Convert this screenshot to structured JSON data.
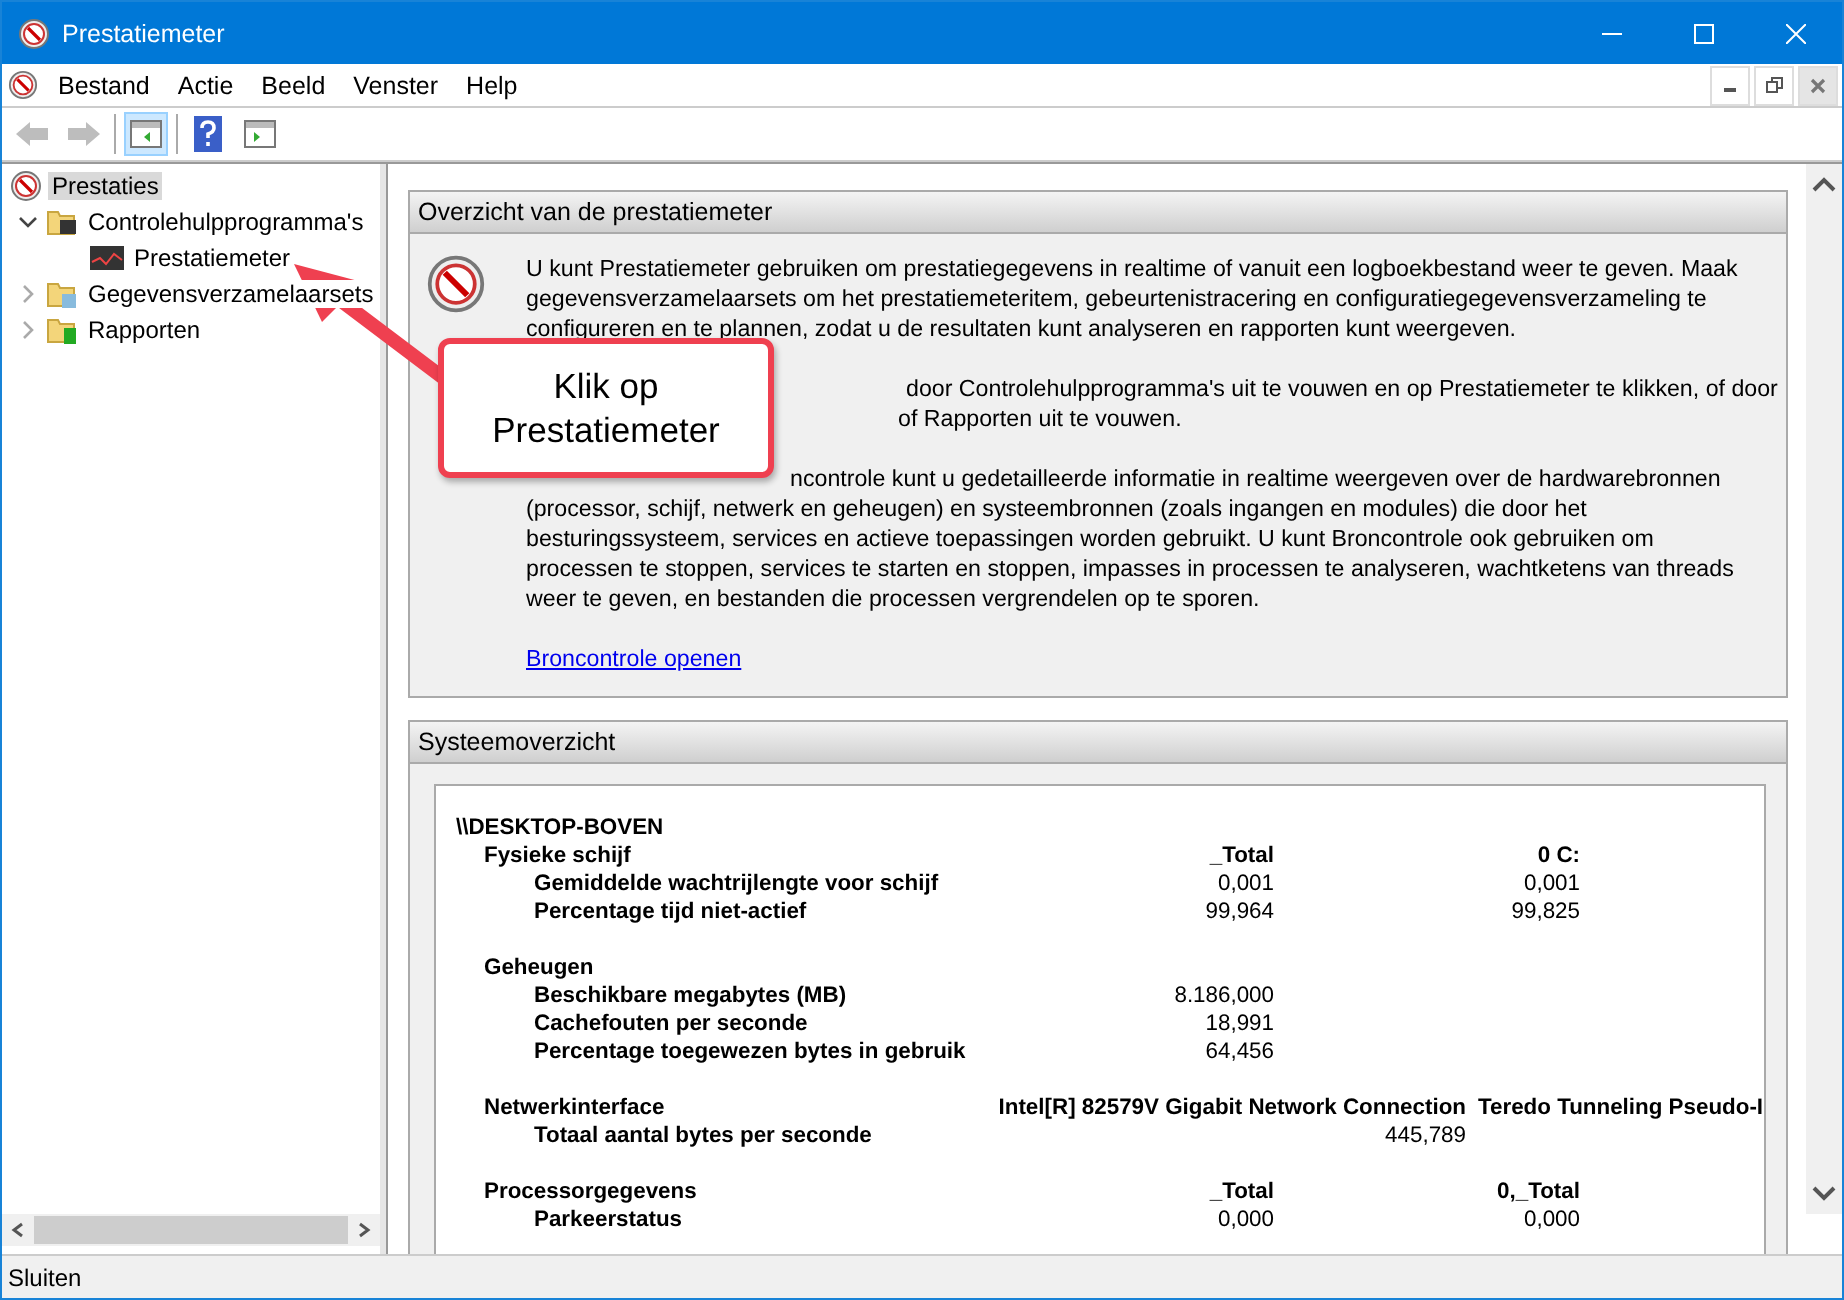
{
  "window": {
    "title": "Prestatiemeter"
  },
  "menu": [
    {
      "label": "Bestand"
    },
    {
      "label": "Actie"
    },
    {
      "label": "Beeld"
    },
    {
      "label": "Venster"
    },
    {
      "label": "Help"
    }
  ],
  "toolbar": [
    {
      "kind": "back",
      "disabled": true
    },
    {
      "kind": "forward",
      "disabled": true
    },
    {
      "kind": "tree",
      "selected": true
    },
    {
      "kind": "help",
      "selected": false
    },
    {
      "kind": "action",
      "selected": false
    }
  ],
  "tree": [
    {
      "label": "Prestaties",
      "selected": true,
      "kind": "gauge",
      "children": [
        {
          "label": "Controlehulpprogramma's",
          "selected": false,
          "expanded": true,
          "kind": "folder-monitor",
          "children": [
            {
              "label": "Prestatiemeter",
              "selected": false,
              "kind": "graph"
            }
          ]
        },
        {
          "label": "Gegevensverzamelaarsets",
          "selected": false,
          "expanded": false,
          "kind": "folder-data"
        },
        {
          "label": "Rapporten",
          "selected": false,
          "expanded": false,
          "kind": "folder-report"
        }
      ]
    }
  ],
  "overview": {
    "title": "Overzicht van de prestatiemeter",
    "paragraphs": [
      [
        "U kunt Prestatiemeter gebruiken om prestatiegegevens in realtime of vanuit een logboekbestand weer te geven. Maak",
        "gegevensverzamelaarsets om het prestatiemeteritem, gebeurtenistracering en configuratiegegevensverzameling te",
        "configureren en te plannen, zodat u de resultaten kunt analyseren en rapporten kunt weergeven."
      ],
      [
        "door Controlehulpprogramma's uit te vouwen en op Prestatiemeter te klikken, of door",
        "of Rapporten uit te vouwen."
      ],
      [
        "ncontrole kunt u gedetailleerde informatie in realtime weergeven over de hardwarebronnen",
        "(processor, schijf, netwerk en geheugen) en systeembronnen (zoals ingangen en modules) die door het",
        "besturingssysteem, services en actieve toepassingen worden gebruikt. U kunt Broncontrole ook gebruiken om",
        "processen te stoppen, services te starten en stoppen, impasses in processen te analyseren, wachtketens van threads",
        "weer te geven, en bestanden die processen vergrendelen op te sporen."
      ]
    ],
    "link": "Broncontrole openen"
  },
  "system": {
    "title": "Systeemoverzicht",
    "host": "\\\\DESKTOP-BOVEN",
    "groups": [
      {
        "name": "Fysieke schijf",
        "kind": "standard",
        "columns": [
          "_Total",
          "0 C:"
        ],
        "counters": [
          {
            "name": "Gemiddelde wachtrijlengte voor schijf",
            "values": [
              "0,001",
              "0,001"
            ]
          },
          {
            "name": "Percentage tijd niet-actief",
            "values": [
              "99,964",
              "99,825"
            ]
          }
        ]
      },
      {
        "name": "Geheugen",
        "kind": "standard",
        "counters": [
          {
            "name": "Beschikbare megabytes (MB)",
            "values": [
              "8.186,000"
            ]
          },
          {
            "name": "Cachefouten per seconde",
            "values": [
              "18,991"
            ]
          },
          {
            "name": "Percentage toegewezen bytes in gebruik",
            "values": [
              "64,456"
            ]
          }
        ]
      },
      {
        "name": "Netwerkinterface",
        "kind": "wide",
        "columns": [
          "Intel[R] 82579V Gigabit Network Connection",
          "Teredo Tunneling Pseudo-I"
        ],
        "counters": [
          {
            "name": "Totaal aantal bytes per seconde",
            "values": [
              "445,789"
            ]
          }
        ]
      },
      {
        "name": "Processorgegevens",
        "kind": "standard",
        "columns": [
          "_Total",
          "0,_Total"
        ],
        "counters": [
          {
            "name": "Parkeerstatus",
            "values": [
              "0,000",
              "0,000"
            ]
          }
        ]
      }
    ]
  },
  "callout": {
    "text": "Klik op Prestatiemeter"
  },
  "status_bar": {
    "text": "Sluiten"
  }
}
